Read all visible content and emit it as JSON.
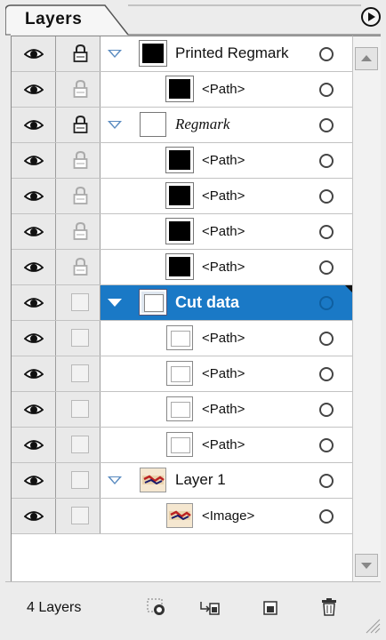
{
  "panel": {
    "tab_label": "Layers",
    "layer_count": "4 Layers"
  },
  "rows": [
    {
      "name": "Printed Regmark",
      "level": 0,
      "expanded": true,
      "visible": true,
      "locked": true,
      "thumb": "black",
      "style": "normal"
    },
    {
      "name": "<Path>",
      "level": 1,
      "visible": true,
      "locked": false,
      "thumb": "black",
      "style": "path"
    },
    {
      "name": "Regmark",
      "level": 0,
      "expanded": true,
      "visible": true,
      "locked": true,
      "thumb": "white",
      "style": "italic"
    },
    {
      "name": "<Path>",
      "level": 1,
      "visible": true,
      "locked": false,
      "thumb": "black",
      "style": "path"
    },
    {
      "name": "<Path>",
      "level": 1,
      "visible": true,
      "locked": false,
      "thumb": "black",
      "style": "path"
    },
    {
      "name": "<Path>",
      "level": 1,
      "visible": true,
      "locked": false,
      "thumb": "black",
      "style": "path"
    },
    {
      "name": "<Path>",
      "level": 1,
      "visible": true,
      "locked": false,
      "thumb": "black",
      "style": "path"
    },
    {
      "name": "Cut data",
      "level": 0,
      "expanded": true,
      "visible": true,
      "locked": false,
      "thumb": "group-cut",
      "style": "bold",
      "selected": true
    },
    {
      "name": "<Path>",
      "level": 1,
      "visible": true,
      "locked": false,
      "thumb": "cut",
      "style": "path"
    },
    {
      "name": "<Path>",
      "level": 1,
      "visible": true,
      "locked": false,
      "thumb": "cut",
      "style": "path"
    },
    {
      "name": "<Path>",
      "level": 1,
      "visible": true,
      "locked": false,
      "thumb": "cut",
      "style": "path"
    },
    {
      "name": "<Path>",
      "level": 1,
      "visible": true,
      "locked": false,
      "thumb": "cut",
      "style": "path"
    },
    {
      "name": "Layer 1",
      "level": 0,
      "expanded": true,
      "visible": true,
      "locked": false,
      "thumb": "img",
      "style": "normal"
    },
    {
      "name": "<Image>",
      "level": 1,
      "visible": true,
      "locked": false,
      "thumb": "img",
      "style": "path"
    }
  ],
  "colors": {
    "selection": "#1a79c6",
    "expand_triangle": "#5a8bc0"
  },
  "icons": {
    "flyout": "flyout-menu-icon",
    "eye": "eye-icon",
    "lock": "lock-icon",
    "make_clipping_mask": "make-clipping-mask-icon",
    "create_sublayer": "create-sublayer-icon",
    "create_layer": "create-new-layer-icon",
    "delete": "trash-icon"
  }
}
